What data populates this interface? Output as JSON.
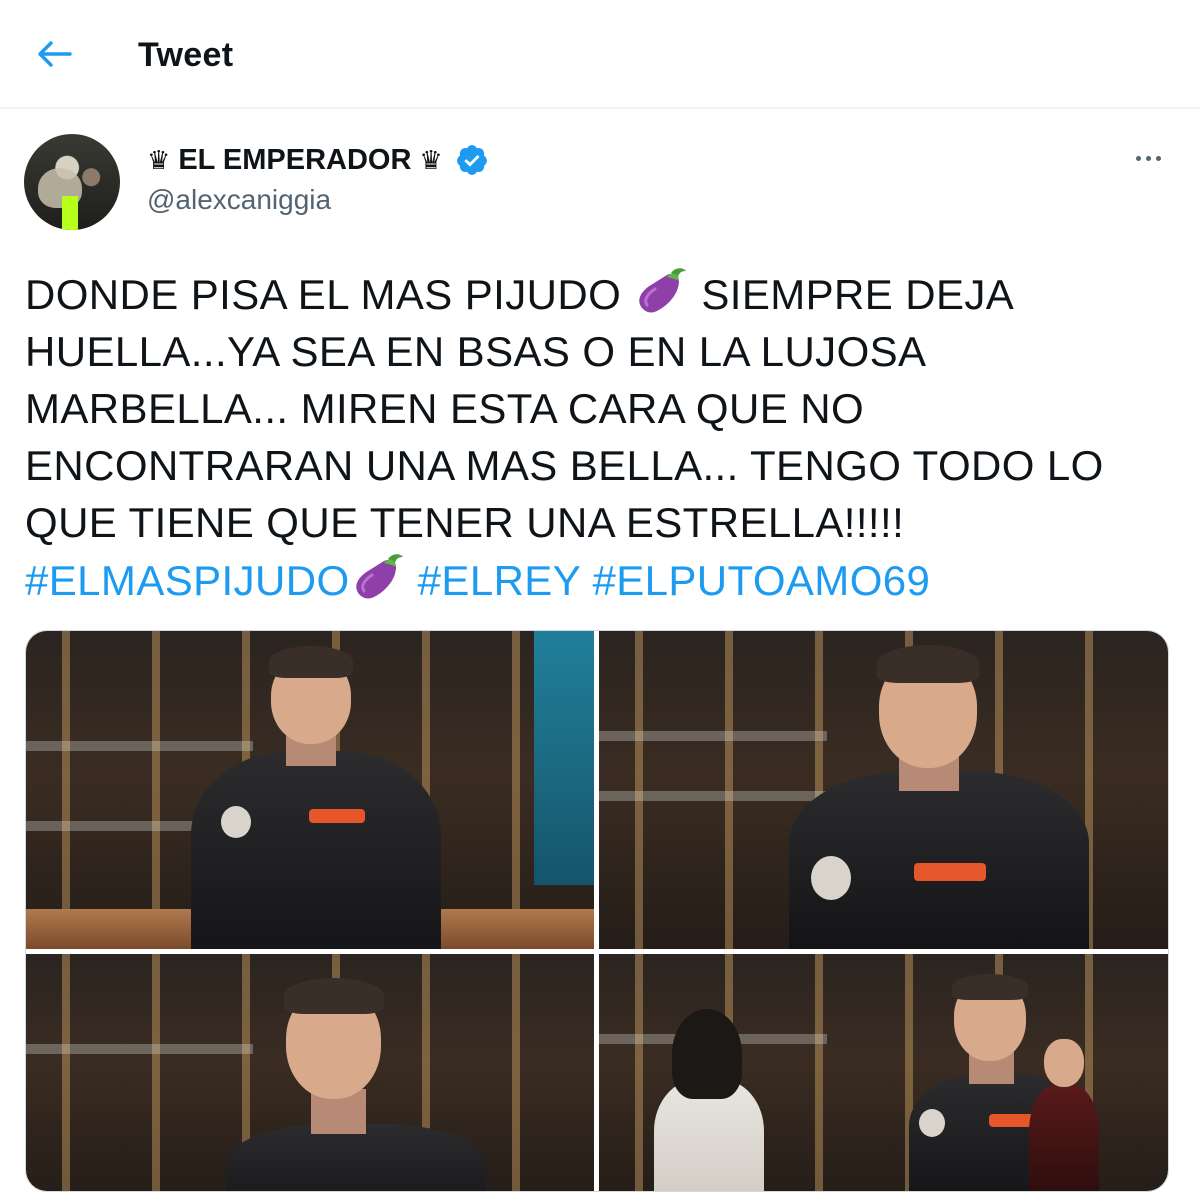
{
  "header": {
    "title": "Tweet"
  },
  "tweet": {
    "author": {
      "crown_left": "♛",
      "name": "EL EMPERADOR",
      "crown_right": "♛",
      "handle": "@alexcaniggia",
      "verified": true
    },
    "text_part1": "DONDE PISA EL MAS PIJUDO ",
    "text_part2": " SIEMPRE DEJA HUELLA...YA SEA EN BSAS O EN LA LUJOSA MARBELLA... MIREN ESTA CARA QUE NO ENCONTRARAN UNA MAS BELLA... TENGO TODO LO QUE TIENE QUE TENER UNA ESTRELLA!!!!!",
    "hashtags": [
      "#ELMASPIJUDO",
      "#ELREY",
      "#ELPUTOAMO69"
    ],
    "emoji": "eggplant-emoji"
  },
  "colors": {
    "accent": "#1d9bf0",
    "text": "#0f1419",
    "secondary": "#536471"
  },
  "media": {
    "count": 4
  }
}
